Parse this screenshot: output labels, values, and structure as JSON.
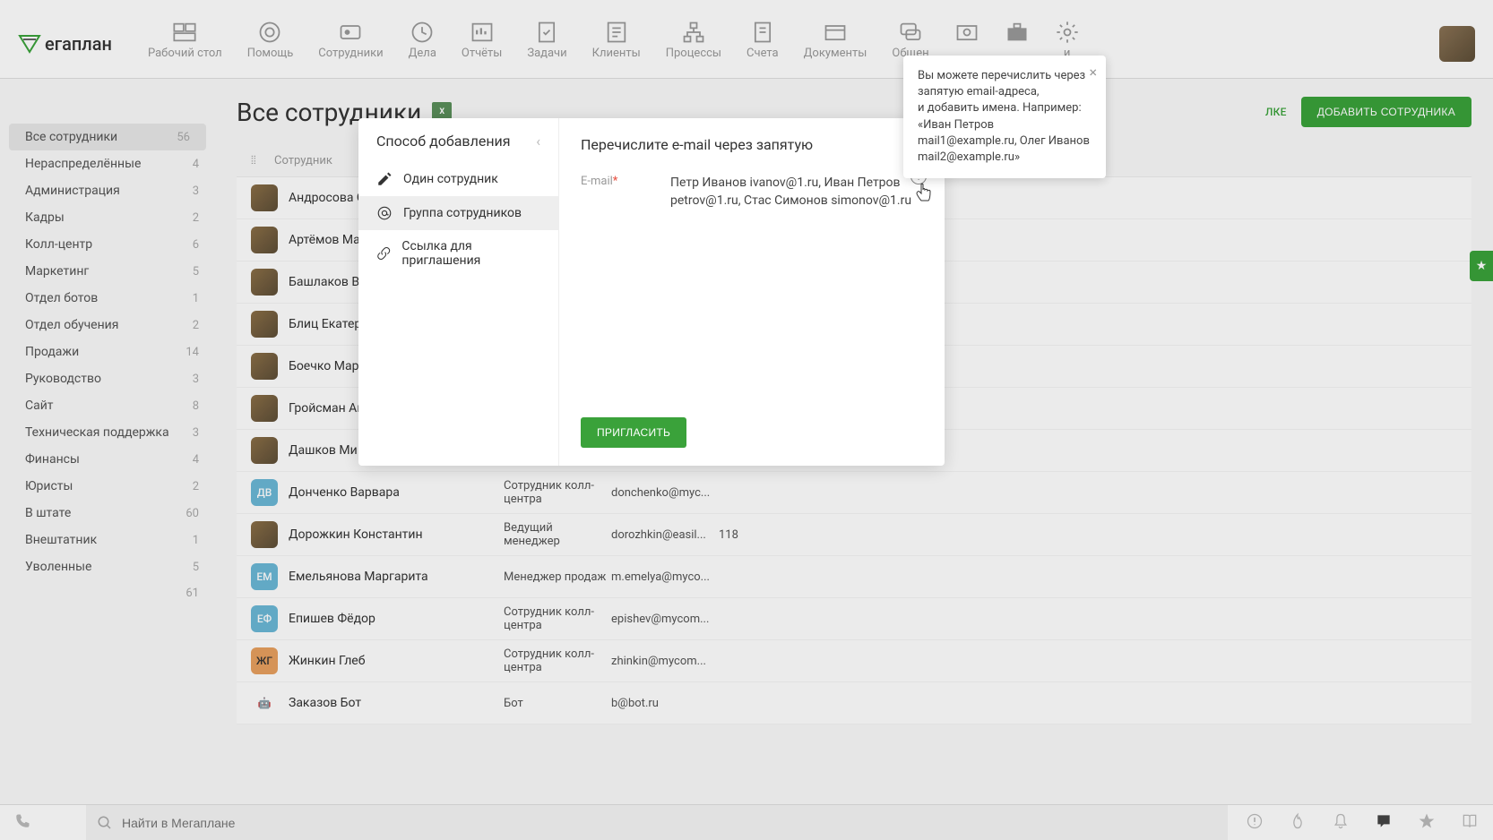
{
  "logo_text": "егаплан",
  "nav": [
    {
      "label": "Рабочий стол"
    },
    {
      "label": "Помощь"
    },
    {
      "label": "Сотрудники"
    },
    {
      "label": "Дела"
    },
    {
      "label": "Отчёты"
    },
    {
      "label": "Задачи"
    },
    {
      "label": "Клиенты"
    },
    {
      "label": "Процессы"
    },
    {
      "label": "Счета"
    },
    {
      "label": "Документы"
    },
    {
      "label": "Общен"
    },
    {
      "label": "и"
    }
  ],
  "page_title": "Все сотрудники",
  "link_button": "ЛКЕ",
  "add_button": "ДОБАВИТЬ СОТРУДНИКА",
  "sidebar": [
    {
      "label": "Все сотрудники",
      "count": "56",
      "active": true
    },
    {
      "label": "Нераспределённые",
      "count": "4"
    },
    {
      "label": "Администрация",
      "count": "3"
    },
    {
      "label": "Кадры",
      "count": "2"
    },
    {
      "label": "Колл-центр",
      "count": "6"
    },
    {
      "label": "Маркетинг",
      "count": "5"
    },
    {
      "label": "Отдел ботов",
      "count": "1"
    },
    {
      "label": "Отдел обучения",
      "count": "2"
    },
    {
      "label": "Продажи",
      "count": "14"
    },
    {
      "label": "Руководство",
      "count": "3"
    },
    {
      "label": "Сайт",
      "count": "8"
    },
    {
      "label": "Техническая поддержка",
      "count": "3"
    },
    {
      "label": "Финансы",
      "count": "4"
    },
    {
      "label": "Юристы",
      "count": "2"
    },
    {
      "label": "В штате",
      "count": "60"
    },
    {
      "label": "Внештатник",
      "count": "1"
    },
    {
      "label": "Уволенные",
      "count": "5"
    },
    {
      "label": "",
      "count": "61"
    }
  ],
  "table_header": "Сотрудник",
  "employees": [
    {
      "initials": "",
      "img": true,
      "name": "Андросова С",
      "role": "",
      "email": "",
      "num": ""
    },
    {
      "initials": "",
      "img": true,
      "name": "Артёмов Ма",
      "role": "",
      "email": "",
      "num": ""
    },
    {
      "initials": "",
      "img": true,
      "name": "Башлаков В",
      "role": "",
      "email": "",
      "num": ""
    },
    {
      "initials": "",
      "img": true,
      "name": "Блиц Екатер",
      "role": "",
      "email": "",
      "num": ""
    },
    {
      "initials": "",
      "img": true,
      "name": "Боечко Мар",
      "role": "",
      "email": "",
      "num": ""
    },
    {
      "initials": "",
      "img": true,
      "name": "Гройсман Ан",
      "role": "",
      "email": "",
      "num": ""
    },
    {
      "initials": "",
      "img": true,
      "name": "Дашков Ми",
      "role": "",
      "email": "",
      "num": ""
    },
    {
      "initials": "ДВ",
      "img": false,
      "name": "Донченко Варвара",
      "role": "Сотрудник колл-центра",
      "email": "donchenko@myc...",
      "num": ""
    },
    {
      "initials": "",
      "img": true,
      "name": "Дорожкин Константин",
      "role": "Ведущий менеджер",
      "email": "dorozhkin@easil...",
      "num": "118"
    },
    {
      "initials": "ЕМ",
      "img": false,
      "name": "Емельянова Маргарита",
      "role": "Менеджер продаж",
      "email": "m.emelya@myco...",
      "num": ""
    },
    {
      "initials": "ЕФ",
      "img": false,
      "name": "Епишев Фёдор",
      "role": "Сотрудник колл-центра",
      "email": "epishev@mycom...",
      "num": ""
    },
    {
      "initials": "ЖГ",
      "img": false,
      "bg": "#e8a05f",
      "name": "Жинкин Глеб",
      "role": "Сотрудник колл-центра",
      "email": "zhinkin@mycom...",
      "num": ""
    },
    {
      "initials": "🤖",
      "img": false,
      "bg": "#fff",
      "name": "Заказов Бот",
      "role": "Бот",
      "email": "b@bot.ru",
      "num": ""
    }
  ],
  "modal": {
    "left_title": "Способ добавления",
    "options": [
      {
        "label": "Один сотрудник",
        "icon": "pencil"
      },
      {
        "label": "Группа сотрудников",
        "icon": "at",
        "active": true
      },
      {
        "label": "Ссылка для приглашения",
        "icon": "link"
      }
    ],
    "right_title": "Перечислите e-mail через запятую",
    "field_label": "E-mail",
    "field_value": "Петр Иванов ivanov@1.ru, Иван Петров petrov@1.ru, Стас Симонов simonov@1.ru",
    "invite_btn": "ПРИГЛАСИТЬ"
  },
  "tooltip": {
    "line1": "Вы можете перечислить через запятую email-адреса,",
    "line2": "и добавить имена. Например: «Иван Петров mail1@example.ru, Олег Иванов mail2@example.ru»"
  },
  "search_placeholder": "Найти в Мегаплане",
  "xls": "X"
}
